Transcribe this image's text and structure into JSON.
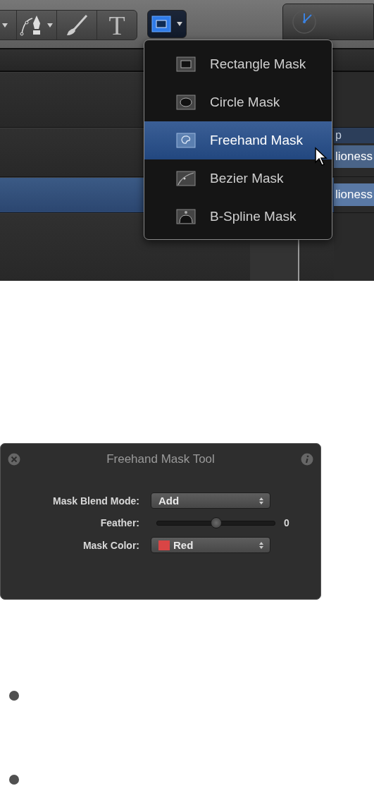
{
  "toolbar": {
    "tools": [
      {
        "kind": "caret"
      },
      {
        "kind": "pen"
      },
      {
        "kind": "brush"
      },
      {
        "kind": "text",
        "glyph": "T"
      }
    ],
    "mask_button": {
      "selected": true
    }
  },
  "timeline": {
    "rows": [
      {
        "selected": false
      },
      {
        "selected": false,
        "header": "p",
        "clip": "lioness"
      },
      {
        "selected": true,
        "clip": "lioness"
      },
      {
        "selected": false
      }
    ]
  },
  "mask_menu": {
    "items": [
      {
        "kind": "rectangle",
        "label": "Rectangle Mask",
        "selected": false
      },
      {
        "kind": "circle",
        "label": "Circle Mask",
        "selected": false
      },
      {
        "kind": "freehand",
        "label": "Freehand Mask",
        "selected": true
      },
      {
        "kind": "bezier",
        "label": "Bezier Mask",
        "selected": false
      },
      {
        "kind": "bspline",
        "label": "B-Spline Mask",
        "selected": false
      }
    ]
  },
  "tool_window": {
    "title": "Freehand Mask Tool",
    "rows": [
      {
        "kind": "popup",
        "label": "Mask Blend Mode:",
        "value": "Add"
      },
      {
        "kind": "slider",
        "label": "Feather:",
        "level": 0.5,
        "reading": "0"
      },
      {
        "kind": "popup",
        "label": "Mask Color:",
        "value": "Red",
        "color": "#d94545"
      }
    ]
  },
  "bullets": [
    {
      "kind": "bullet"
    },
    {
      "kind": "bullet"
    }
  ]
}
